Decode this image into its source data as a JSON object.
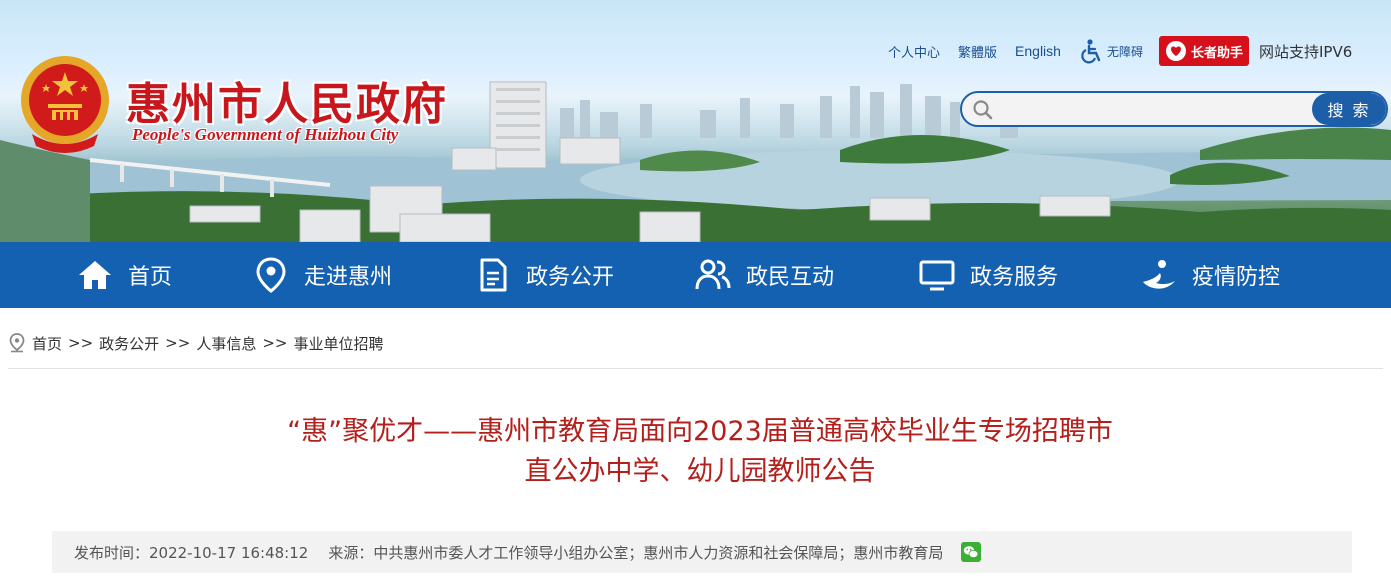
{
  "header": {
    "site_title": "惠州市人民政府",
    "site_subtitle": "People's Government of Huizhou City",
    "links": {
      "personal_center": "个人中心",
      "traditional": "繁體版",
      "english": "English",
      "accessibility": "无障碍",
      "elder_assistant": "长者助手",
      "ipv6": "网站支持IPV6"
    },
    "search": {
      "placeholder": "",
      "button": "搜 索"
    }
  },
  "nav": {
    "items": [
      {
        "label": "首页",
        "icon": "home-icon"
      },
      {
        "label": "走进惠州",
        "icon": "location-pin-icon"
      },
      {
        "label": "政务公开",
        "icon": "document-icon"
      },
      {
        "label": "政民互动",
        "icon": "people-icon"
      },
      {
        "label": "政务服务",
        "icon": "monitor-icon"
      },
      {
        "label": "疫情防控",
        "icon": "health-hand-icon"
      }
    ]
  },
  "breadcrumb": {
    "items": [
      "首页",
      "政务公开",
      "人事信息",
      "事业单位招聘"
    ],
    "separator": ">>"
  },
  "article": {
    "title_line1": "“惠”聚优才——惠州市教育局面向2023届普通高校毕业生专场招聘市",
    "title_line2": "直公办中学、幼儿园教师公告",
    "publish_time": "发布时间：2022-10-17 16:48:12",
    "source": "来源：中共惠州市委人才工作领导小组办公室；惠州市人力资源和社会保障局；惠州市教育局",
    "share_icon": "wechat-icon"
  },
  "colors": {
    "brand_red": "#c8161d",
    "nav_blue": "#1461b1",
    "title_red": "#b3201c",
    "link_blue": "#1a4f8f"
  }
}
